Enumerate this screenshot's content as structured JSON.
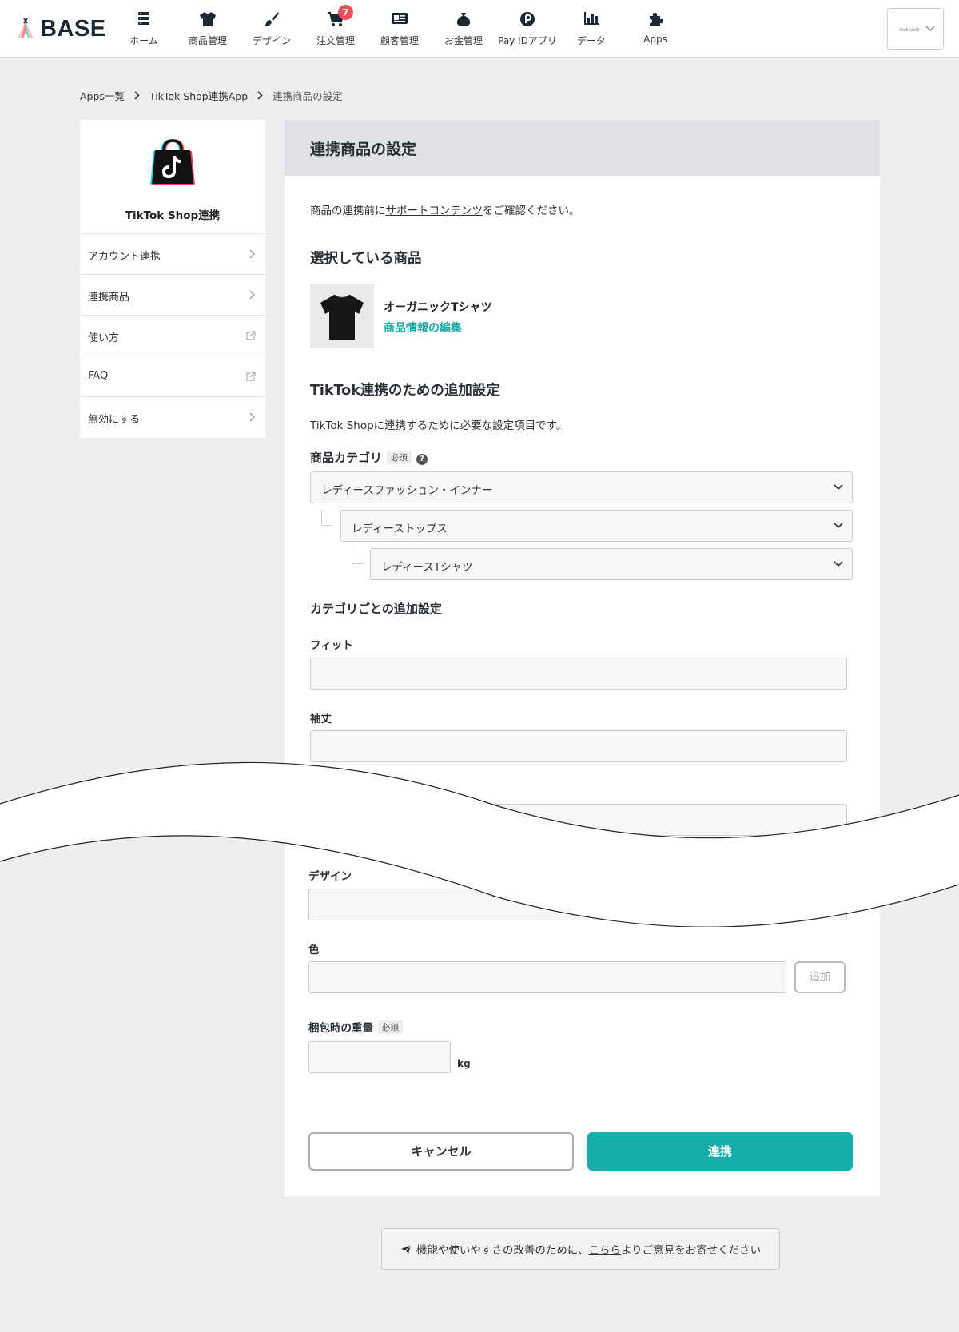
{
  "header": {
    "logo_text": "BASE",
    "nav": [
      {
        "label": "ホーム",
        "icon": "server-icon"
      },
      {
        "label": "商品管理",
        "icon": "tshirt-icon"
      },
      {
        "label": "デザイン",
        "icon": "brush-icon"
      },
      {
        "label": "注文管理",
        "icon": "cart-icon",
        "badge": "7"
      },
      {
        "label": "顧客管理",
        "icon": "id-card-icon"
      },
      {
        "label": "お金管理",
        "icon": "money-bag-icon"
      },
      {
        "label": "Pay IDアプリ",
        "icon": "payid-icon"
      },
      {
        "label": "データ",
        "icon": "bar-chart-icon"
      },
      {
        "label": "Apps",
        "icon": "puzzle-icon"
      }
    ],
    "shop_logo_text": "YOUR SHOP"
  },
  "breadcrumb": {
    "items": [
      "Apps一覧",
      "TikTok Shop連携App"
    ],
    "current": "連携商品の設定"
  },
  "sidebar": {
    "app_name": "TikTok Shop連携",
    "items": [
      {
        "label": "アカウント連携",
        "icon": "chevron-right-icon"
      },
      {
        "label": "連携商品",
        "icon": "chevron-right-icon"
      },
      {
        "label": "使い方",
        "icon": "external-link-icon"
      },
      {
        "label": "FAQ",
        "icon": "external-link-icon"
      },
      {
        "label": "無効にする",
        "icon": "chevron-right-icon"
      }
    ]
  },
  "main": {
    "title": "連携商品の設定",
    "intro_before": "商品の連携前に",
    "intro_link": "サポートコンテンツ",
    "intro_after": "をご確認ください。",
    "selected_heading": "選択している商品",
    "product_name": "オーガニックTシャツ",
    "product_edit_link": "商品情報の編集",
    "additional_heading": "TikTok連携のための追加設定",
    "additional_desc": "TikTok Shopに連携するために必要な設定項目です。",
    "category_label": "商品カテゴリ",
    "required_badge": "必須",
    "category_level1": "レディースファッション・インナー",
    "category_level2": "レディーストップス",
    "category_level3": "レディースTシャツ",
    "per_category_heading": "カテゴリごとの追加設定",
    "field_fit_label": "フィット",
    "field_sleeve_label": "袖丈",
    "field_design_label": "デザイン",
    "field_color_label": "色",
    "add_button": "追加",
    "weight_label": "梱包時の重量",
    "weight_unit": "kg",
    "cancel_button": "キャンセル",
    "submit_button": "連携"
  },
  "feedback": {
    "before": "機能や使いやすさの改善のために、",
    "link": "こちら",
    "after": "よりご意見をお寄せください"
  },
  "colors": {
    "accent": "#12aea7",
    "badge": "#e8515d",
    "background": "#eeeef0",
    "panel_header": "#dfe1e4"
  }
}
